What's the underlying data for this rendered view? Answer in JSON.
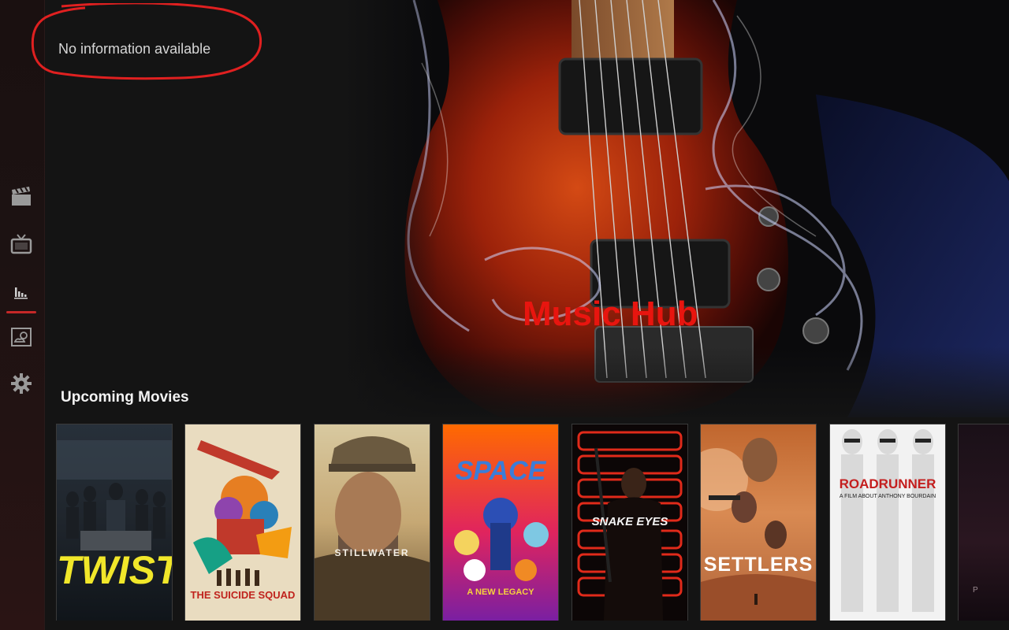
{
  "info": {
    "text": "No information available"
  },
  "hero": {
    "title": "Music Hub"
  },
  "sidebar": {
    "items": [
      {
        "icon": "clapperboard-icon"
      },
      {
        "icon": "tv-icon"
      },
      {
        "icon": "music-bars-icon",
        "active": true
      },
      {
        "icon": "weather-icon"
      },
      {
        "icon": "gear-icon"
      }
    ]
  },
  "row": {
    "title": "Upcoming Movies",
    "posters": [
      {
        "title": "TWIST"
      },
      {
        "title": "THE SUICIDE SQUAD"
      },
      {
        "title": "STILLWATER"
      },
      {
        "title": "SPACE",
        "subtitle": "A NEW LEGACY"
      },
      {
        "title": "SNAKE EYES"
      },
      {
        "title": "SETTLERS"
      },
      {
        "title": "ROADRUNNER",
        "subtitle": "A FILM ABOUT ANTHONY BOURDAIN"
      },
      {
        "title": "P"
      }
    ]
  },
  "colors": {
    "accent": "#c62828",
    "hero_title": "#e8150f",
    "annotation": "#e02020"
  }
}
